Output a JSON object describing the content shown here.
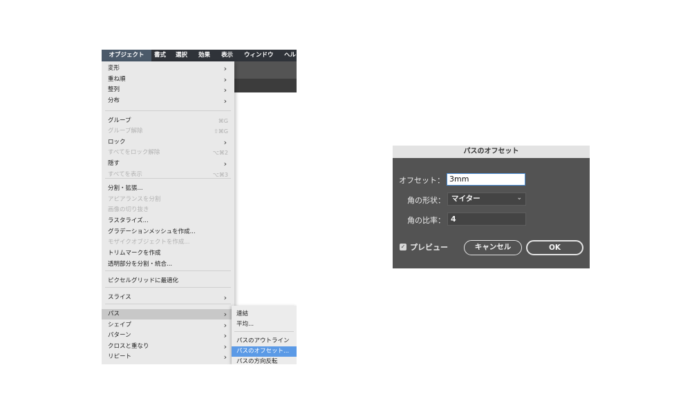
{
  "menubar": {
    "items": [
      "オブジェクト",
      "書式",
      "選択",
      "効果",
      "表示",
      "ウィンドウ",
      "ヘル"
    ]
  },
  "object_menu": {
    "items": [
      {
        "label": "変形",
        "submenu": true
      },
      {
        "label": "重ね順",
        "submenu": true
      },
      {
        "label": "整列",
        "submenu": true
      },
      {
        "label": "分布",
        "submenu": true
      },
      {
        "label": "グループ",
        "shortcut": "⌘G"
      },
      {
        "label": "グループ解除",
        "shortcut": "⇧⌘G",
        "disabled": true
      },
      {
        "label": "ロック",
        "submenu": true
      },
      {
        "label": "すべてをロック解除",
        "shortcut": "⌥⌘2",
        "disabled": true
      },
      {
        "label": "隠す",
        "submenu": true
      },
      {
        "label": "すべてを表示",
        "shortcut": "⌥⌘3",
        "disabled": true
      },
      {
        "label": "分割・拡張..."
      },
      {
        "label": "アピアランスを分割",
        "disabled": true
      },
      {
        "label": "画像の切り抜き",
        "disabled": true
      },
      {
        "label": "ラスタライズ..."
      },
      {
        "label": "グラデーションメッシュを作成..."
      },
      {
        "label": "モザイクオブジェクトを作成...",
        "disabled": true
      },
      {
        "label": "トリムマークを作成"
      },
      {
        "label": "透明部分を分割・統合..."
      },
      {
        "label": "ピクセルグリッドに最適化"
      },
      {
        "label": "スライス",
        "submenu": true
      },
      {
        "label": "パス",
        "submenu": true,
        "highlighted": true
      },
      {
        "label": "シェイプ",
        "submenu": true
      },
      {
        "label": "パターン",
        "submenu": true
      },
      {
        "label": "クロスと重なり",
        "submenu": true
      },
      {
        "label": "リピート",
        "submenu": true
      }
    ],
    "arrow": "›"
  },
  "path_submenu": {
    "items": [
      {
        "label": "連結"
      },
      {
        "label": "平均..."
      },
      {
        "label": "パスのアウトライン"
      },
      {
        "label": "パスのオフセット...",
        "selected": true
      },
      {
        "label": "パスの方向反転"
      }
    ]
  },
  "dialog": {
    "title": "パスのオフセット",
    "offset_label": "オフセット：",
    "offset_value": "3mm",
    "joins_label": "角の形状：",
    "joins_value": "マイター",
    "miter_label": "角の比率：",
    "miter_value": "4",
    "preview_label": "プレビュー",
    "preview_checked": true,
    "cancel_label": "キャンセル",
    "ok_label": "OK",
    "accent_color": "#4a8fd9",
    "background_color": "#535353"
  },
  "icons": {
    "check": "check-icon",
    "chevron": "chevron-down-icon",
    "submenu_arrow": "chevron-right-icon"
  }
}
